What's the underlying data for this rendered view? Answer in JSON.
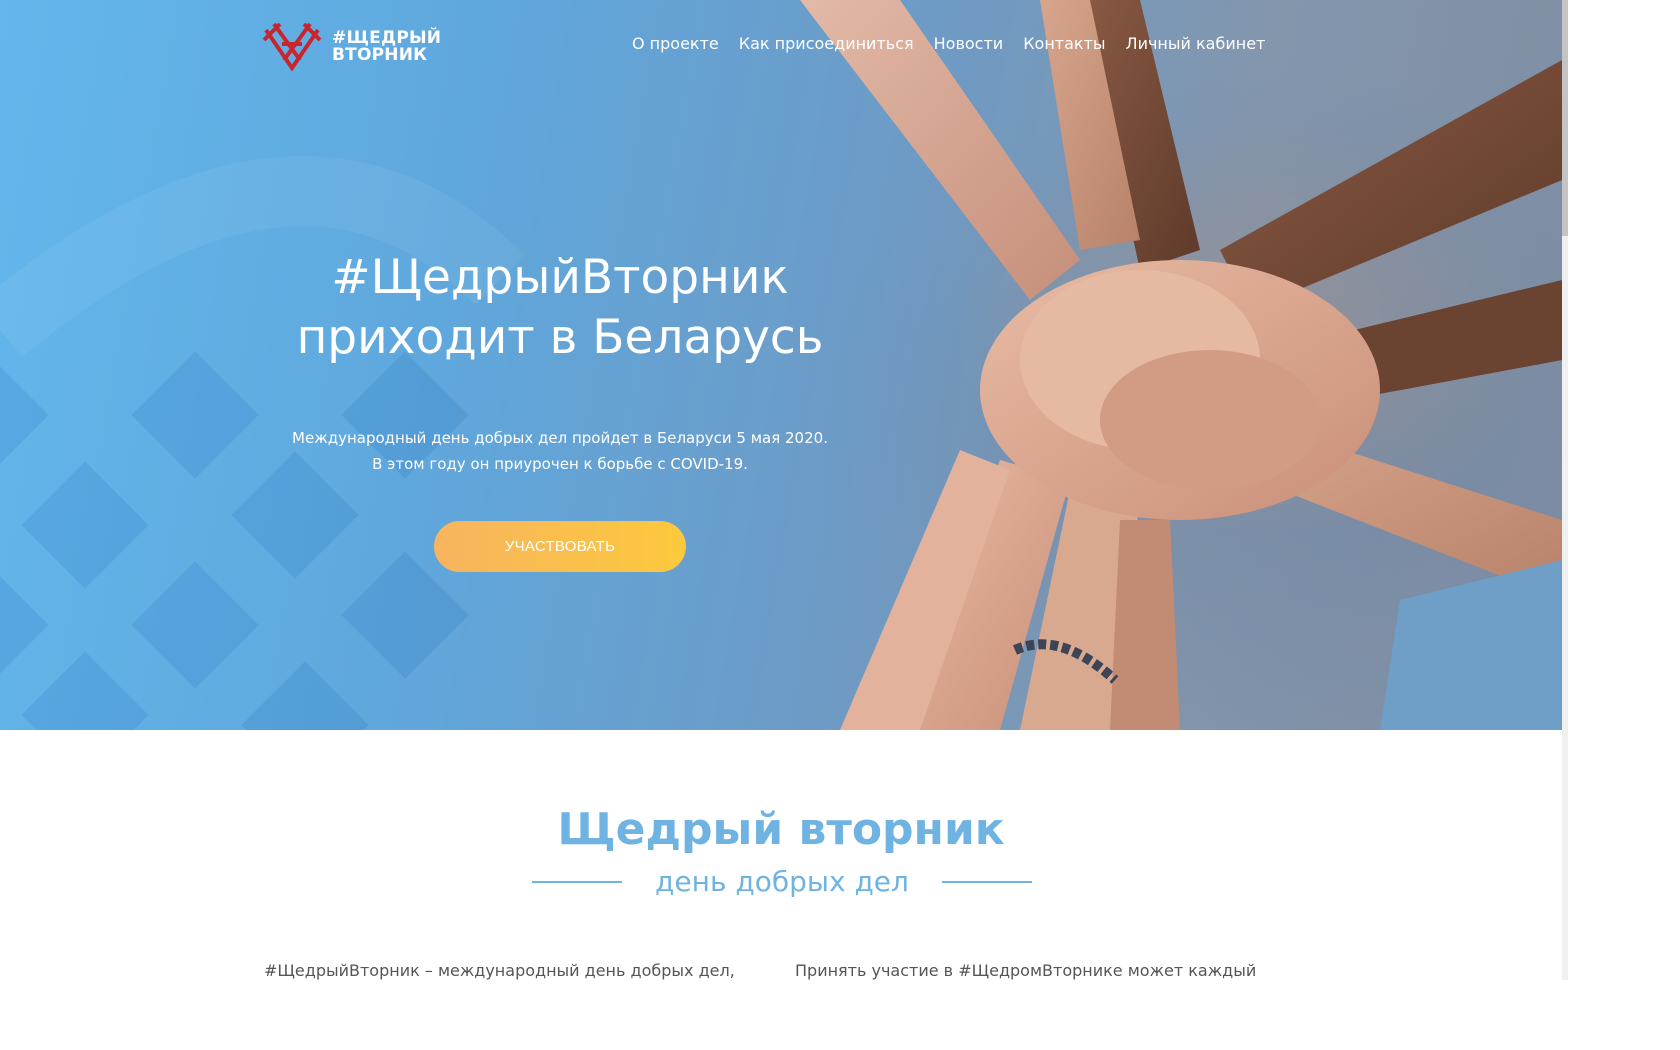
{
  "brand": {
    "line1": "#ЩЕДРЫЙ",
    "line2": "ВТОРНИК",
    "heart_color": "#c8252f"
  },
  "nav": [
    {
      "label": "О проекте"
    },
    {
      "label": "Как присоединиться"
    },
    {
      "label": "Новости"
    },
    {
      "label": "Контакты"
    },
    {
      "label": "Личный кабинет"
    }
  ],
  "hero": {
    "title_line1": "#ЩедрыйВторник",
    "title_line2": "приходит в Беларусь",
    "subtitle_line1": "Международный день добрых дел пройдет в Беларуси 5 мая 2020.",
    "subtitle_line2": "В этом году он приурочен к борьбе с COVID-19.",
    "cta_label": "УЧАСТВОВАТЬ"
  },
  "section": {
    "title": "Щедрый вторник",
    "subtitle": "день добрых дел",
    "para_left": "#ЩедрыйВторник – международный день добрых дел,",
    "para_right": "Принять участие в #ЩедромВторнике может каждый"
  },
  "colors": {
    "accent": "#6fb3e3",
    "cta_start": "#f7b45f",
    "cta_end": "#fcc93c",
    "hero_blue": "#63b7ec"
  }
}
